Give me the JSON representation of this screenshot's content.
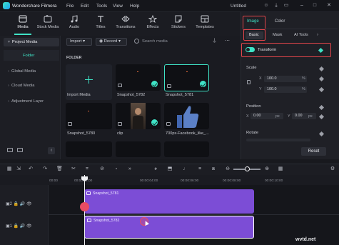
{
  "app": {
    "name": "Wondershare Filmora",
    "doc_title": "Untitled"
  },
  "menu": [
    "File",
    "Edit",
    "Tools",
    "View",
    "Help"
  ],
  "toolbar": {
    "items": [
      "Media",
      "Stock Media",
      "Audio",
      "Titles",
      "Transitions",
      "Effects",
      "Stickers",
      "Templates"
    ],
    "active": "Media"
  },
  "leftnav": {
    "project_media": "Project Media",
    "folder": "Folder",
    "global_media": "Global Media",
    "cloud_media": "Cloud Media",
    "adjustment_layer": "Adjustment Layer"
  },
  "media": {
    "import_label": "Import",
    "record_label": "Record",
    "search_placeholder": "Search media",
    "folder_heading": "FOLDER",
    "items": [
      {
        "label": "Import Media"
      },
      {
        "label": "Snapshot_5782"
      },
      {
        "label": "Snapshot_5781"
      },
      {
        "label": "Snapshot_5780"
      },
      {
        "label": "clip"
      },
      {
        "label": "700px-Facebook_like_..."
      }
    ]
  },
  "right_panel": {
    "tabs": [
      "Image",
      "Color"
    ],
    "active_tab": "Image",
    "subtabs": [
      "Basic",
      "Mask",
      "AI Tools"
    ],
    "active_subtab": "Basic",
    "transform_label": "Transform",
    "transform_on": true,
    "scale_label": "Scale",
    "scale_x_axis": "X",
    "scale_y_axis": "Y",
    "scale_x": "100.0",
    "scale_y": "100.0",
    "percent": "%",
    "position_label": "Position",
    "pos_x_axis": "X",
    "pos_y_axis": "Y",
    "pos_x": "0.00",
    "pos_y": "0.00",
    "px": "px",
    "rotate_label": "Rotate",
    "reset_label": "Reset"
  },
  "timeline": {
    "ticks": [
      "00:00",
      "00:00:02:00",
      "00:00:04:00",
      "00:00:06:00",
      "00:00:08:00",
      "00:00:10:00"
    ],
    "clip1": "Snapshot_5781",
    "clip2": "Snapshot_5782"
  },
  "watermark": "wvtd.net",
  "colors": {
    "accent": "#3fe3c6",
    "clip": "#7c4dd6",
    "highlight_box": "#e2454a"
  }
}
